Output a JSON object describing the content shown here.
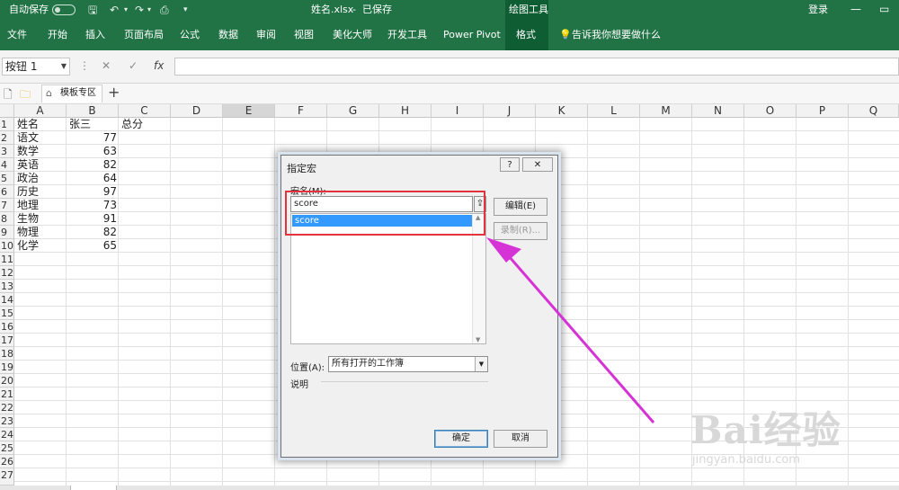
{
  "titlebar": {
    "autosave_label": "自动保存",
    "filename": "姓名.xlsx",
    "save_status": "已保存",
    "context_group": "绘图工具",
    "login": "登录",
    "minimize": "—",
    "restore": "▭"
  },
  "ribbon": {
    "tabs": [
      "文件",
      "开始",
      "插入",
      "页面布局",
      "公式",
      "数据",
      "审阅",
      "视图",
      "美化大师",
      "开发工具",
      "Power Pivot",
      "格式"
    ],
    "active_tab": "格式",
    "tell_me": "告诉我你想要做什么"
  },
  "formula_bar": {
    "name_box": "按钮 1",
    "cancel_icon": "✕",
    "enter_icon": "✓",
    "fx_label": "fx",
    "formula": ""
  },
  "doc_tabs": {
    "template_tab": "模板专区",
    "add": "+"
  },
  "sheet": {
    "columns": [
      "A",
      "B",
      "C",
      "D",
      "E",
      "F",
      "G",
      "H",
      "I",
      "J",
      "K",
      "L",
      "M",
      "N",
      "O",
      "P",
      "Q"
    ],
    "selected_column": "E",
    "rows": [
      "1",
      "2",
      "3",
      "4",
      "5",
      "6",
      "7",
      "8",
      "9",
      "10",
      "11",
      "12",
      "13",
      "14",
      "15",
      "16",
      "17",
      "18",
      "19",
      "20",
      "21",
      "22",
      "23",
      "24",
      "25",
      "26",
      "27"
    ],
    "header_row": {
      "a": "姓名",
      "b": "张三",
      "c": "总分"
    },
    "data": [
      {
        "subject": "语文",
        "score": "77"
      },
      {
        "subject": "数学",
        "score": "63"
      },
      {
        "subject": "英语",
        "score": "82"
      },
      {
        "subject": "政治",
        "score": "64"
      },
      {
        "subject": "历史",
        "score": "97"
      },
      {
        "subject": "地理",
        "score": "73"
      },
      {
        "subject": "生物",
        "score": "91"
      },
      {
        "subject": "物理",
        "score": "82"
      },
      {
        "subject": "化学",
        "score": "65"
      }
    ]
  },
  "dialog": {
    "title": "指定宏",
    "help": "?",
    "close": "✕",
    "macro_name_label": "宏名(M):",
    "macro_name_value": "score",
    "list_items": [
      "score"
    ],
    "edit_button": "编辑(E)",
    "record_button": "录制(R)...",
    "location_label": "位置(A):",
    "location_value": "所有打开的工作簿",
    "description_label": "说明",
    "ok_button": "确定",
    "cancel_button": "取消"
  },
  "watermark": {
    "brand": "Bai经验",
    "url": "jingyan.baidu.com"
  },
  "colors": {
    "ribbon": "#217346",
    "annotation_box": "#e2333f",
    "annotation_arrow": "#d633d6",
    "selection": "#3399ff"
  }
}
